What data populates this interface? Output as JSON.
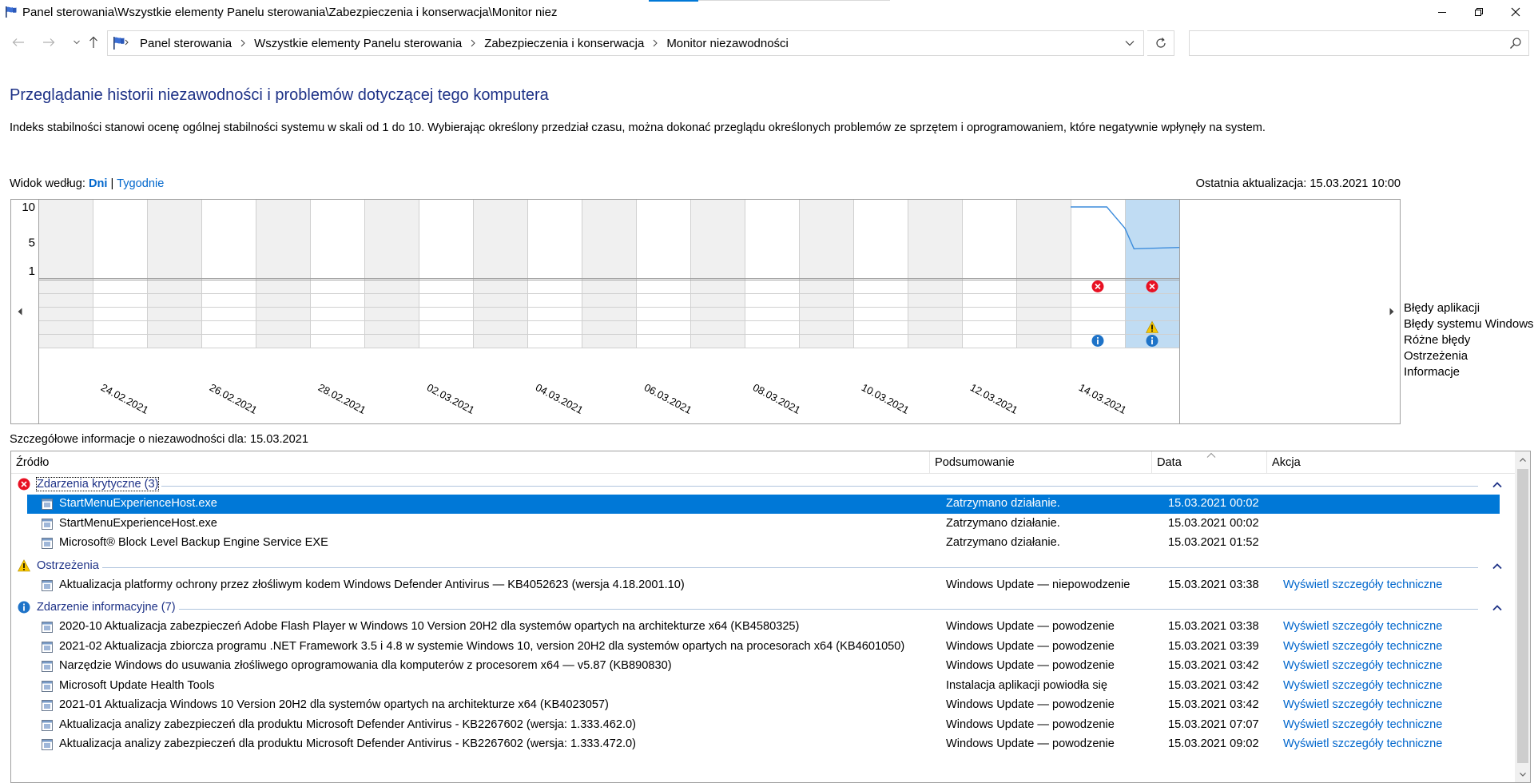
{
  "window": {
    "title": "Panel sterowania\\Wszystkie elementy Panelu sterowania\\Zabezpieczenia i konserwacja\\Monitor niez"
  },
  "address": {
    "crumbs": [
      "Panel sterowania",
      "Wszystkie elementy Panelu sterowania",
      "Zabezpieczenia i konserwacja",
      "Monitor niezawodności"
    ],
    "search_placeholder": ""
  },
  "header": {
    "title": "Przeglądanie historii niezawodności i problemów dotyczącej tego komputera",
    "description": "Indeks stabilności stanowi ocenę ogólnej stabilności systemu w skali od 1 do 10. Wybierając określony przedział czasu, można dokonać przeglądu określonych problemów ze sprzętem i oprogramowaniem, które negatywnie wpłynęły na system.",
    "view_by_label": "Widok według:",
    "view_days": "Dni",
    "view_separator": "|",
    "view_weeks": "Tygodnie",
    "last_update": "Ostatnia aktualizacja: 15.03.2021 10:00"
  },
  "chart_data": {
    "type": "line",
    "title": "",
    "yticks": [
      "10",
      "5",
      "1"
    ],
    "ylim": [
      1,
      10
    ],
    "x": [
      "23.02.2021",
      "24.02.2021",
      "25.02.2021",
      "26.02.2021",
      "27.02.2021",
      "28.02.2021",
      "01.03.2021",
      "02.03.2021",
      "03.03.2021",
      "04.03.2021",
      "05.03.2021",
      "06.03.2021",
      "07.03.2021",
      "08.03.2021",
      "09.03.2021",
      "10.03.2021",
      "11.03.2021",
      "12.03.2021",
      "13.03.2021",
      "14.03.2021",
      "15.03.2021"
    ],
    "xtick_labels": [
      "24.02.2021",
      "26.02.2021",
      "28.02.2021",
      "02.03.2021",
      "04.03.2021",
      "06.03.2021",
      "08.03.2021",
      "10.03.2021",
      "12.03.2021",
      "14.03.2021"
    ],
    "selected": "15.03.2021",
    "series": [
      {
        "values": [
          null,
          null,
          null,
          null,
          null,
          null,
          null,
          null,
          null,
          null,
          null,
          null,
          null,
          null,
          null,
          null,
          null,
          null,
          null,
          10,
          4.2
        ]
      }
    ],
    "stability_points": [
      {
        "x": "14.03.2021 00:00",
        "y": 10
      },
      {
        "x": "14.03.2021 16:00",
        "y": 10
      },
      {
        "x": "15.03.2021 00:00",
        "y": 7.0
      },
      {
        "x": "15.03.2021 04:00",
        "y": 4.1
      },
      {
        "x": "15.03.2021 24:00",
        "y": 4.3
      }
    ],
    "event_rows": [
      "Błędy aplikacji",
      "Błędy systemu Windows",
      "Różne błędy",
      "Ostrzeżenia",
      "Informacje"
    ],
    "events": [
      {
        "day": "14.03.2021",
        "row": "Błędy aplikacji",
        "icon": "error-icon"
      },
      {
        "day": "15.03.2021",
        "row": "Błędy aplikacji",
        "icon": "error-icon"
      },
      {
        "day": "15.03.2021",
        "row": "Ostrzeżenia",
        "icon": "warning-icon"
      },
      {
        "day": "14.03.2021",
        "row": "Informacje",
        "icon": "info-icon"
      },
      {
        "day": "15.03.2021",
        "row": "Informacje",
        "icon": "info-icon"
      }
    ],
    "colors": {
      "line": "#3c8cdc",
      "selected_fill": "#c0dcf3",
      "shade": "#f0f0f0",
      "grid": "#d0d0d0"
    }
  },
  "details": {
    "title": "Szczegółowe informacje o niezawodności dla: 15.03.2021",
    "columns": [
      "Źródło",
      "Podsumowanie",
      "Data",
      "Akcja"
    ],
    "groups": [
      {
        "label": "Zdarzenia krytyczne (3)",
        "icon": "error-icon",
        "rows": [
          {
            "source": "StartMenuExperienceHost.exe",
            "summary": "Zatrzymano działanie.",
            "date": "15.03.2021 00:02",
            "action": ""
          },
          {
            "source": "StartMenuExperienceHost.exe",
            "summary": "Zatrzymano działanie.",
            "date": "15.03.2021 00:02",
            "action": ""
          },
          {
            "source": "Microsoft® Block Level Backup Engine Service EXE",
            "summary": "Zatrzymano działanie.",
            "date": "15.03.2021 01:52",
            "action": ""
          }
        ]
      },
      {
        "label": "Ostrzeżenia",
        "icon": "warning-icon",
        "rows": [
          {
            "source": "Aktualizacja platformy ochrony przez złośliwym kodem Windows Defender Antivirus — KB4052623 (wersja 4.18.2001.10)",
            "summary": "Windows Update — niepowodzenie",
            "date": "15.03.2021 03:38",
            "action": "Wyświetl szczegóły techniczne"
          }
        ]
      },
      {
        "label": "Zdarzenie informacyjne (7)",
        "icon": "info-icon",
        "rows": [
          {
            "source": "2020-10 Aktualizacja zabezpieczeń Adobe Flash Player w Windows 10 Version 20H2 dla systemów opartych na architekturze x64 (KB4580325)",
            "summary": "Windows Update — powodzenie",
            "date": "15.03.2021 03:38",
            "action": "Wyświetl szczegóły techniczne"
          },
          {
            "source": "2021-02 Aktualizacja zbiorcza programu .NET Framework 3.5 i 4.8 w systemie Windows 10, version 20H2 dla systemów opartych na procesorach x64 (KB4601050)",
            "summary": "Windows Update — powodzenie",
            "date": "15.03.2021 03:39",
            "action": "Wyświetl szczegóły techniczne"
          },
          {
            "source": "Narzędzie Windows do usuwania złośliwego oprogramowania dla komputerów z procesorem x64 — v5.87 (KB890830)",
            "summary": "Windows Update — powodzenie",
            "date": "15.03.2021 03:42",
            "action": "Wyświetl szczegóły techniczne"
          },
          {
            "source": "Microsoft Update Health Tools",
            "summary": "Instalacja aplikacji powiodła się",
            "date": "15.03.2021 03:42",
            "action": "Wyświetl szczegóły techniczne"
          },
          {
            "source": "2021-01 Aktualizacja Windows 10 Version 20H2 dla systemów opartych na architekturze x64 (KB4023057)",
            "summary": "Windows Update — powodzenie",
            "date": "15.03.2021 03:42",
            "action": "Wyświetl szczegóły techniczne"
          },
          {
            "source": "Aktualizacja analizy zabezpieczeń dla produktu Microsoft Defender Antivirus - KB2267602 (wersja: 1.333.462.0)",
            "summary": "Windows Update — powodzenie",
            "date": "15.03.2021 07:07",
            "action": "Wyświetl szczegóły techniczne"
          },
          {
            "source": "Aktualizacja analizy zabezpieczeń dla produktu Microsoft Defender Antivirus - KB2267602 (wersja: 1.333.472.0)",
            "summary": "Windows Update — powodzenie",
            "date": "15.03.2021 09:02",
            "action": "Wyświetl szczegóły techniczne"
          }
        ]
      }
    ]
  }
}
